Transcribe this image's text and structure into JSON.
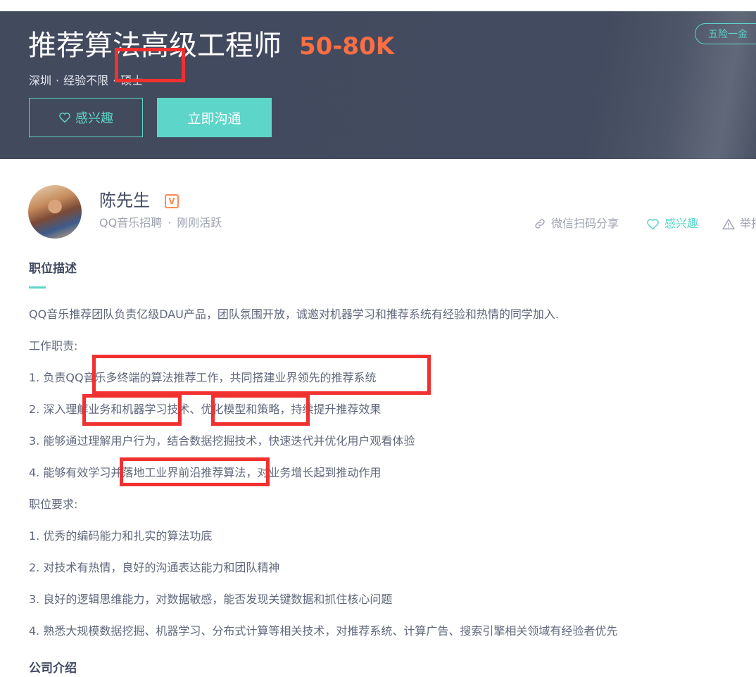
{
  "job": {
    "title": "推荐算法高级工程师",
    "salary": "50-80K",
    "city": "深圳",
    "experience": "经验不限",
    "education": "硕士",
    "separator": "·",
    "benefit": "五险一金"
  },
  "buttons": {
    "interest": "感兴趣",
    "chat": "立即沟通"
  },
  "recruiter": {
    "name": "陈先生",
    "badge": "V",
    "company_role": "QQ音乐招聘",
    "separator": "·",
    "status": "刚刚活跃"
  },
  "actions": {
    "share": "微信扫码分享",
    "interest": "感兴趣",
    "report": "举报"
  },
  "description": {
    "title": "职位描述",
    "lines": [
      "QQ音乐推荐团队负责亿级DAU产品，团队氛围开放，诚邀对机器学习和推荐系统有经验和热情的同学加入.",
      "工作职责:",
      "1. 负责QQ音乐多终端的算法推荐工作，共同搭建业界领先的推荐系统",
      "2. 深入理解业务和机器学习技术、优化模型和策略，持续提升推荐效果",
      "3. 能够通过理解用户行为，结合数据挖掘技术，快速迭代并优化用户观看体验",
      "4. 能够有效学习并落地工业界前沿推荐算法，对业务增长起到推动作用",
      "职位要求:",
      "1. 优秀的编码能力和扎实的算法功底",
      "2. 对技术有热情，良好的沟通表达能力和团队精神",
      "3. 良好的逻辑思维能力，对数据敏感，能否发现关键数据和抓住核心问题",
      "4. 熟悉大规模数据挖掘、机器学习、分布式计算等相关技术，对推荐系统、计算广告、搜索引擎相关领域有经验者优先"
    ]
  },
  "company": {
    "title": "公司介绍"
  },
  "colors": {
    "banner": "#434b60",
    "accent": "#5dd5c8",
    "salary": "#fd6e42",
    "highlight": "#f0312f"
  }
}
